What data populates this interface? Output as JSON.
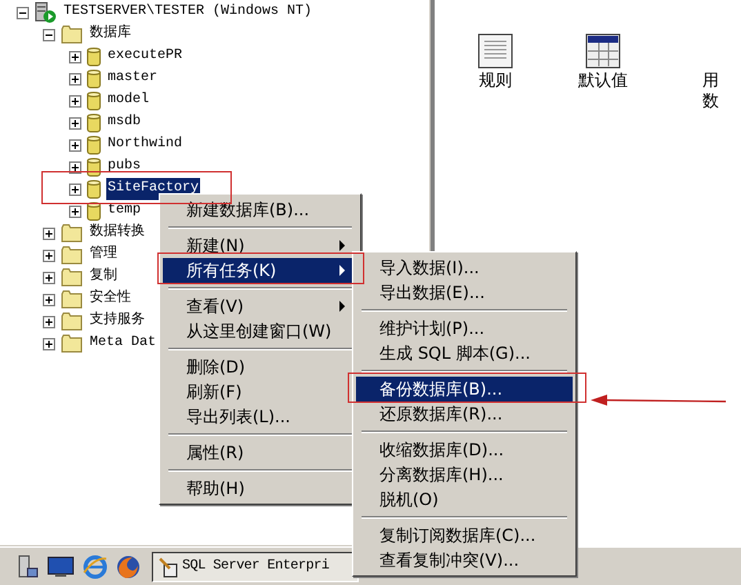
{
  "tree": {
    "label": "TESTSERVER\\TESTER (Windows NT)",
    "kind": "server",
    "expanded": true,
    "selected": false,
    "children": [
      {
        "label": "数据库",
        "kind": "folder",
        "expanded": true,
        "selected": false,
        "children": [
          {
            "label": "executePR",
            "kind": "database",
            "expanded": false,
            "selected": false
          },
          {
            "label": "master",
            "kind": "database",
            "expanded": false,
            "selected": false
          },
          {
            "label": "model",
            "kind": "database",
            "expanded": false,
            "selected": false
          },
          {
            "label": "msdb",
            "kind": "database",
            "expanded": false,
            "selected": false
          },
          {
            "label": "Northwind",
            "kind": "database",
            "expanded": false,
            "selected": false
          },
          {
            "label": "pubs",
            "kind": "database",
            "expanded": false,
            "selected": false
          },
          {
            "label": "SiteFactory",
            "kind": "database",
            "expanded": false,
            "selected": true
          },
          {
            "label": "temp",
            "kind": "database",
            "expanded": false,
            "selected": false
          }
        ]
      },
      {
        "label": "数据转换",
        "kind": "folder",
        "expanded": false,
        "selected": false
      },
      {
        "label": "管理",
        "kind": "folder",
        "expanded": false,
        "selected": false
      },
      {
        "label": "复制",
        "kind": "folder",
        "expanded": false,
        "selected": false
      },
      {
        "label": "安全性",
        "kind": "folder",
        "expanded": false,
        "selected": false
      },
      {
        "label": "支持服务",
        "kind": "folder",
        "expanded": false,
        "selected": false
      },
      {
        "label": "Meta Dat",
        "kind": "folder",
        "expanded": false,
        "selected": false
      }
    ]
  },
  "right_pane": {
    "icons": [
      {
        "kind": "rules",
        "lines": [
          "规则"
        ]
      },
      {
        "kind": "defaults",
        "lines": [
          "默认值"
        ]
      },
      {
        "kind": "types",
        "lines": [
          "用",
          "数"
        ]
      }
    ]
  },
  "context_menu": {
    "items": [
      {
        "kind": "item",
        "label": "新建数据库(B)...",
        "submenu": false,
        "selected": false
      },
      {
        "kind": "separator"
      },
      {
        "kind": "item",
        "label": "新建(N)",
        "submenu": true,
        "selected": false
      },
      {
        "kind": "item",
        "label": "所有任务(K)",
        "submenu": true,
        "selected": true
      },
      {
        "kind": "separator"
      },
      {
        "kind": "item",
        "label": "查看(V)",
        "submenu": true,
        "selected": false
      },
      {
        "kind": "item",
        "label": "从这里创建窗口(W)",
        "submenu": false,
        "selected": false
      },
      {
        "kind": "separator"
      },
      {
        "kind": "item",
        "label": "删除(D)",
        "submenu": false,
        "selected": false
      },
      {
        "kind": "item",
        "label": "刷新(F)",
        "submenu": false,
        "selected": false
      },
      {
        "kind": "item",
        "label": "导出列表(L)...",
        "submenu": false,
        "selected": false
      },
      {
        "kind": "separator"
      },
      {
        "kind": "item",
        "label": "属性(R)",
        "submenu": false,
        "selected": false
      },
      {
        "kind": "separator"
      },
      {
        "kind": "item",
        "label": "帮助(H)",
        "submenu": false,
        "selected": false
      }
    ]
  },
  "submenu": {
    "items": [
      {
        "kind": "item",
        "label": "导入数据(I)...",
        "submenu": false,
        "selected": false
      },
      {
        "kind": "item",
        "label": "导出数据(E)...",
        "submenu": false,
        "selected": false
      },
      {
        "kind": "separator"
      },
      {
        "kind": "item",
        "label": "维护计划(P)...",
        "submenu": false,
        "selected": false
      },
      {
        "kind": "item",
        "label": "生成 SQL 脚本(G)...",
        "submenu": false,
        "selected": false
      },
      {
        "kind": "separator"
      },
      {
        "kind": "item",
        "label": "备份数据库(B)...",
        "submenu": false,
        "selected": true
      },
      {
        "kind": "item",
        "label": "还原数据库(R)...",
        "submenu": false,
        "selected": false
      },
      {
        "kind": "separator"
      },
      {
        "kind": "item",
        "label": "收缩数据库(D)...",
        "submenu": false,
        "selected": false
      },
      {
        "kind": "item",
        "label": "分离数据库(H)...",
        "submenu": false,
        "selected": false
      },
      {
        "kind": "item",
        "label": "脱机(O)",
        "submenu": false,
        "selected": false
      },
      {
        "kind": "separator"
      },
      {
        "kind": "item",
        "label": "复制订阅数据库(C)...",
        "submenu": false,
        "selected": false
      },
      {
        "kind": "item",
        "label": "查看复制冲突(V)...",
        "submenu": false,
        "selected": false
      }
    ]
  },
  "taskbar": {
    "task_button": "SQL Server Enterpri"
  }
}
